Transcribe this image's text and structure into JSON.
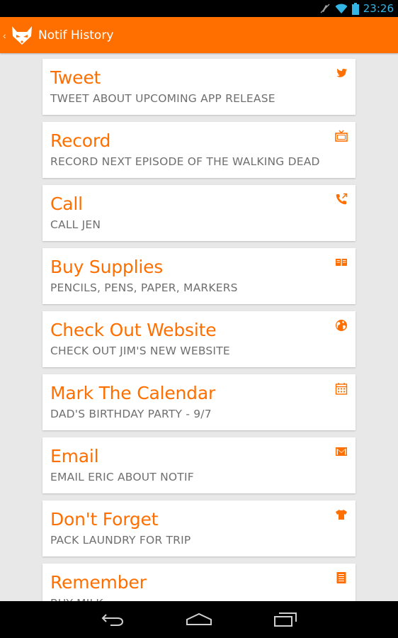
{
  "status_bar": {
    "time": "23:26",
    "icons": [
      "mute-icon",
      "wifi-icon",
      "battery-icon"
    ]
  },
  "action_bar": {
    "title": "Notif History",
    "logo": "fox-logo-icon",
    "background": "#ff6f00"
  },
  "colors": {
    "accent": "#ff6f00",
    "subtitle": "#6f6f6f",
    "status_blue": "#33b5e5"
  },
  "items": [
    {
      "title": "Tweet",
      "subtitle": "TWEET ABOUT UPCOMING APP RELEASE",
      "icon": "twitter-bird-icon"
    },
    {
      "title": "Record",
      "subtitle": "RECORD NEXT EPISODE OF THE WALKING DEAD",
      "icon": "tv-icon"
    },
    {
      "title": "Call",
      "subtitle": "CALL JEN",
      "icon": "phone-outgoing-icon"
    },
    {
      "title": "Buy Supplies",
      "subtitle": "PENCILS, PENS, PAPER, MARKERS",
      "icon": "book-icon"
    },
    {
      "title": "Check Out Website",
      "subtitle": "CHECK OUT JIM'S NEW WEBSITE",
      "icon": "globe-icon"
    },
    {
      "title": "Mark The Calendar",
      "subtitle": "DAD'S BIRTHDAY PARTY - 9/7",
      "icon": "calendar-icon"
    },
    {
      "title": "Email",
      "subtitle": "EMAIL ERIC ABOUT NOTIF",
      "icon": "envelope-icon"
    },
    {
      "title": "Don't Forget",
      "subtitle": "PACK LAUNDRY FOR TRIP",
      "icon": "tshirt-icon"
    },
    {
      "title": "Remember",
      "subtitle": "BUY MILK",
      "icon": "note-list-icon"
    }
  ],
  "nav_bar": {
    "buttons": [
      "back-icon",
      "home-icon",
      "recent-apps-icon"
    ]
  }
}
